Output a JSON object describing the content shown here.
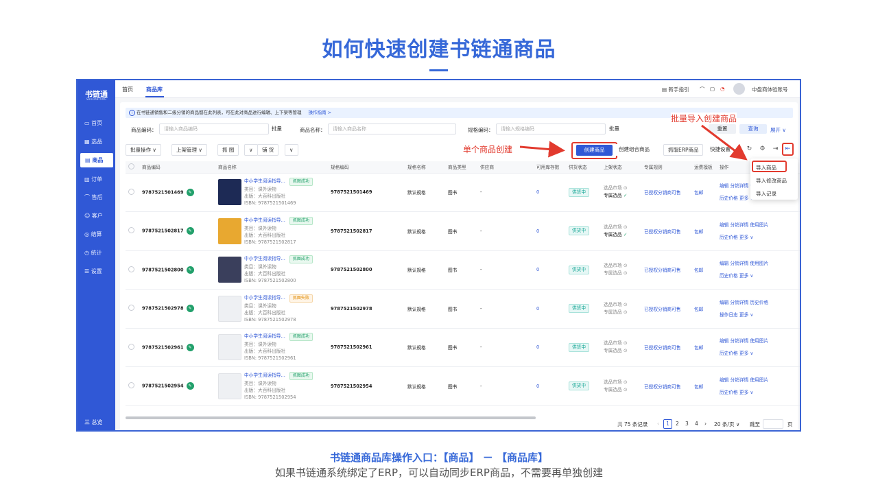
{
  "slide": {
    "title": "如何快速创建书链通商品",
    "caption1": "书链通商品库操作入口：【商品】 － 【商品库】",
    "caption2": "如果书链通系统绑定了ERP，可以自动同步ERP商品，不需要再单独创建"
  },
  "colors": {
    "brand": "#3058d6",
    "annotation": "#e23a2e",
    "sidebar": "#3058d6"
  },
  "sidebar": {
    "logo": "书链通",
    "logo_sub": "SHULIANTONG",
    "items": [
      {
        "label": "首页",
        "icon": "monitor-icon"
      },
      {
        "label": "选品",
        "icon": "grid-icon"
      },
      {
        "label": "商品",
        "icon": "box-icon",
        "active": true
      },
      {
        "label": "订单",
        "icon": "doc-icon"
      },
      {
        "label": "售后",
        "icon": "headset-icon"
      },
      {
        "label": "客户",
        "icon": "users-icon"
      },
      {
        "label": "结算",
        "icon": "coin-icon"
      },
      {
        "label": "统计",
        "icon": "clock-icon"
      },
      {
        "label": "设置",
        "icon": "sliders-icon"
      }
    ],
    "bottom": "三 总览"
  },
  "topbar": {
    "nav": [
      "首页",
      "商品库"
    ],
    "guide": "新手指引",
    "account": "中盘商体验账号"
  },
  "notice": {
    "text": "在书链通销售和二级分销的商品都在此列表，可在此对商品进行编辑、上下架等管理",
    "link": "操作指南 >"
  },
  "filters": {
    "code_label": "商品编码：",
    "code_placeholder": "请输入商品编码",
    "batch": "批量",
    "name_label": "商品名称：",
    "name_placeholder": "请输入商品名称",
    "spec_label": "规格编码：",
    "spec_placeholder": "请输入规格编码",
    "reset": "重置",
    "query": "查询",
    "expand": "展开 ∨"
  },
  "toolbar": {
    "batch_ops": "批量操作 ∨",
    "shelf_mgmt": "上架管理 ∨",
    "grab": "抓 图",
    "grab_arrow": "∨",
    "stock": "铺 货",
    "stock_arrow": "∨",
    "create": "创建商品",
    "create_combo": "创建组合商品",
    "grab_erp": "抓取ERP商品",
    "quick_set": "快捷设置"
  },
  "annotations": {
    "single": "单个商品创建",
    "batch_import": "批量导入创建商品"
  },
  "dropdown": [
    "导入商品",
    "导入修改商品",
    "导入记录"
  ],
  "table": {
    "headers": [
      "商品编码",
      "商品名称",
      "规格编码",
      "规格名称",
      "商品类型",
      "供应商",
      "可用库存数",
      "供货状态",
      "上架状态",
      "专属规则",
      "运费模板",
      "操作"
    ],
    "rows": [
      {
        "code": "9787521501469",
        "name": "中小学生阅读指导...",
        "tag": "抓图成功",
        "tag_type": "ok",
        "category": "类目：课外读物",
        "publisher": "出版：大百科出版社",
        "isbn": "ISBN: 9787521501469",
        "spec_code": "9787521501469",
        "spec_name": "默认规格",
        "type": "图书",
        "supplier": "-",
        "stock": "0",
        "supply": "供货中",
        "shelf1": "选品市场",
        "shelf2": "专属选品",
        "shelf2_ok": true,
        "rule": "已授权分销商可售",
        "freight": "包邮",
        "ops1": "编辑  分销详情  使用图片",
        "ops2": "历史价格  更多 ∨",
        "thumb": "#1d2a55"
      },
      {
        "code": "9787521502817",
        "name": "中小学生阅读指导...",
        "tag": "抓图成功",
        "tag_type": "ok",
        "category": "类目：课外读物",
        "publisher": "出版：大百科出版社",
        "isbn": "ISBN: 9787521502817",
        "spec_code": "9787521502817",
        "spec_name": "默认规格",
        "type": "图书",
        "supplier": "-",
        "stock": "0",
        "supply": "供货中",
        "shelf1": "选品市场",
        "shelf2": "专属选品",
        "shelf2_ok": true,
        "rule": "已授权分销商可售",
        "freight": "包邮",
        "ops1": "编辑  分销详情  使用图片",
        "ops2": "历史价格  更多 ∨",
        "thumb": "#e8a830"
      },
      {
        "code": "9787521502800",
        "name": "中小学生阅读指导...",
        "tag": "抓图成功",
        "tag_type": "ok",
        "category": "类目：课外读物",
        "publisher": "出版：大百科出版社",
        "isbn": "ISBN: 9787521502800",
        "spec_code": "9787521502800",
        "spec_name": "默认规格",
        "type": "图书",
        "supplier": "-",
        "stock": "0",
        "supply": "供货中",
        "shelf1": "选品市场",
        "shelf2": "专属选品",
        "shelf2_ok": false,
        "rule": "已授权分销商可售",
        "freight": "包邮",
        "ops1": "编辑  分销详情  使用图片",
        "ops2": "历史价格  更多 ∨",
        "thumb": "#3a3f5c"
      },
      {
        "code": "9787521502978",
        "name": "中小学生阅读指导...",
        "tag": "抓图失败",
        "tag_type": "fail",
        "category": "类目：课外读物",
        "publisher": "出版：大百科出版社",
        "isbn": "ISBN: 9787521502978",
        "spec_code": "9787521502978",
        "spec_name": "默认规格",
        "type": "图书",
        "supplier": "-",
        "stock": "0",
        "supply": "供货中",
        "shelf1": "选品市场",
        "shelf2": "专属选品",
        "shelf2_ok": false,
        "rule": "已授权分销商可售",
        "freight": "包邮",
        "ops1": "编辑  分销详情  历史价格",
        "ops2": "操作日志  更多 ∨",
        "thumb": "#eef0f3"
      },
      {
        "code": "9787521502961",
        "name": "中小学生阅读指导...",
        "tag": "抓图成功",
        "tag_type": "ok",
        "category": "类目：课外读物",
        "publisher": "出版：大百科出版社",
        "isbn": "ISBN: 9787521502961",
        "spec_code": "9787521502961",
        "spec_name": "默认规格",
        "type": "图书",
        "supplier": "-",
        "stock": "0",
        "supply": "供货中",
        "shelf1": "选品市场",
        "shelf2": "专属选品",
        "shelf2_ok": false,
        "rule": "已授权分销商可售",
        "freight": "包邮",
        "ops1": "编辑  分销详情  使用图片",
        "ops2": "历史价格  更多 ∨",
        "thumb": "#eef0f3"
      },
      {
        "code": "9787521502954",
        "name": "中小学生阅读指导...",
        "tag": "抓图成功",
        "tag_type": "ok",
        "category": "类目：课外读物",
        "publisher": "出版：大百科出版社",
        "isbn": "ISBN: 9787521502954",
        "spec_code": "9787521502954",
        "spec_name": "默认规格",
        "type": "图书",
        "supplier": "-",
        "stock": "0",
        "supply": "供货中",
        "shelf1": "选品市场",
        "shelf2": "专属选品",
        "shelf2_ok": false,
        "rule": "已授权分销商可售",
        "freight": "包邮",
        "ops1": "编辑  分销详情  使用图片",
        "ops2": "历史价格  更多 ∨",
        "thumb": "#eef0f3"
      }
    ]
  },
  "pagination": {
    "total": "共 75 条记录",
    "pages": [
      "1",
      "2",
      "3",
      "4"
    ],
    "current": "1",
    "page_size": "20 条/页 ∨",
    "jump": "跳至",
    "page_unit": "页"
  }
}
